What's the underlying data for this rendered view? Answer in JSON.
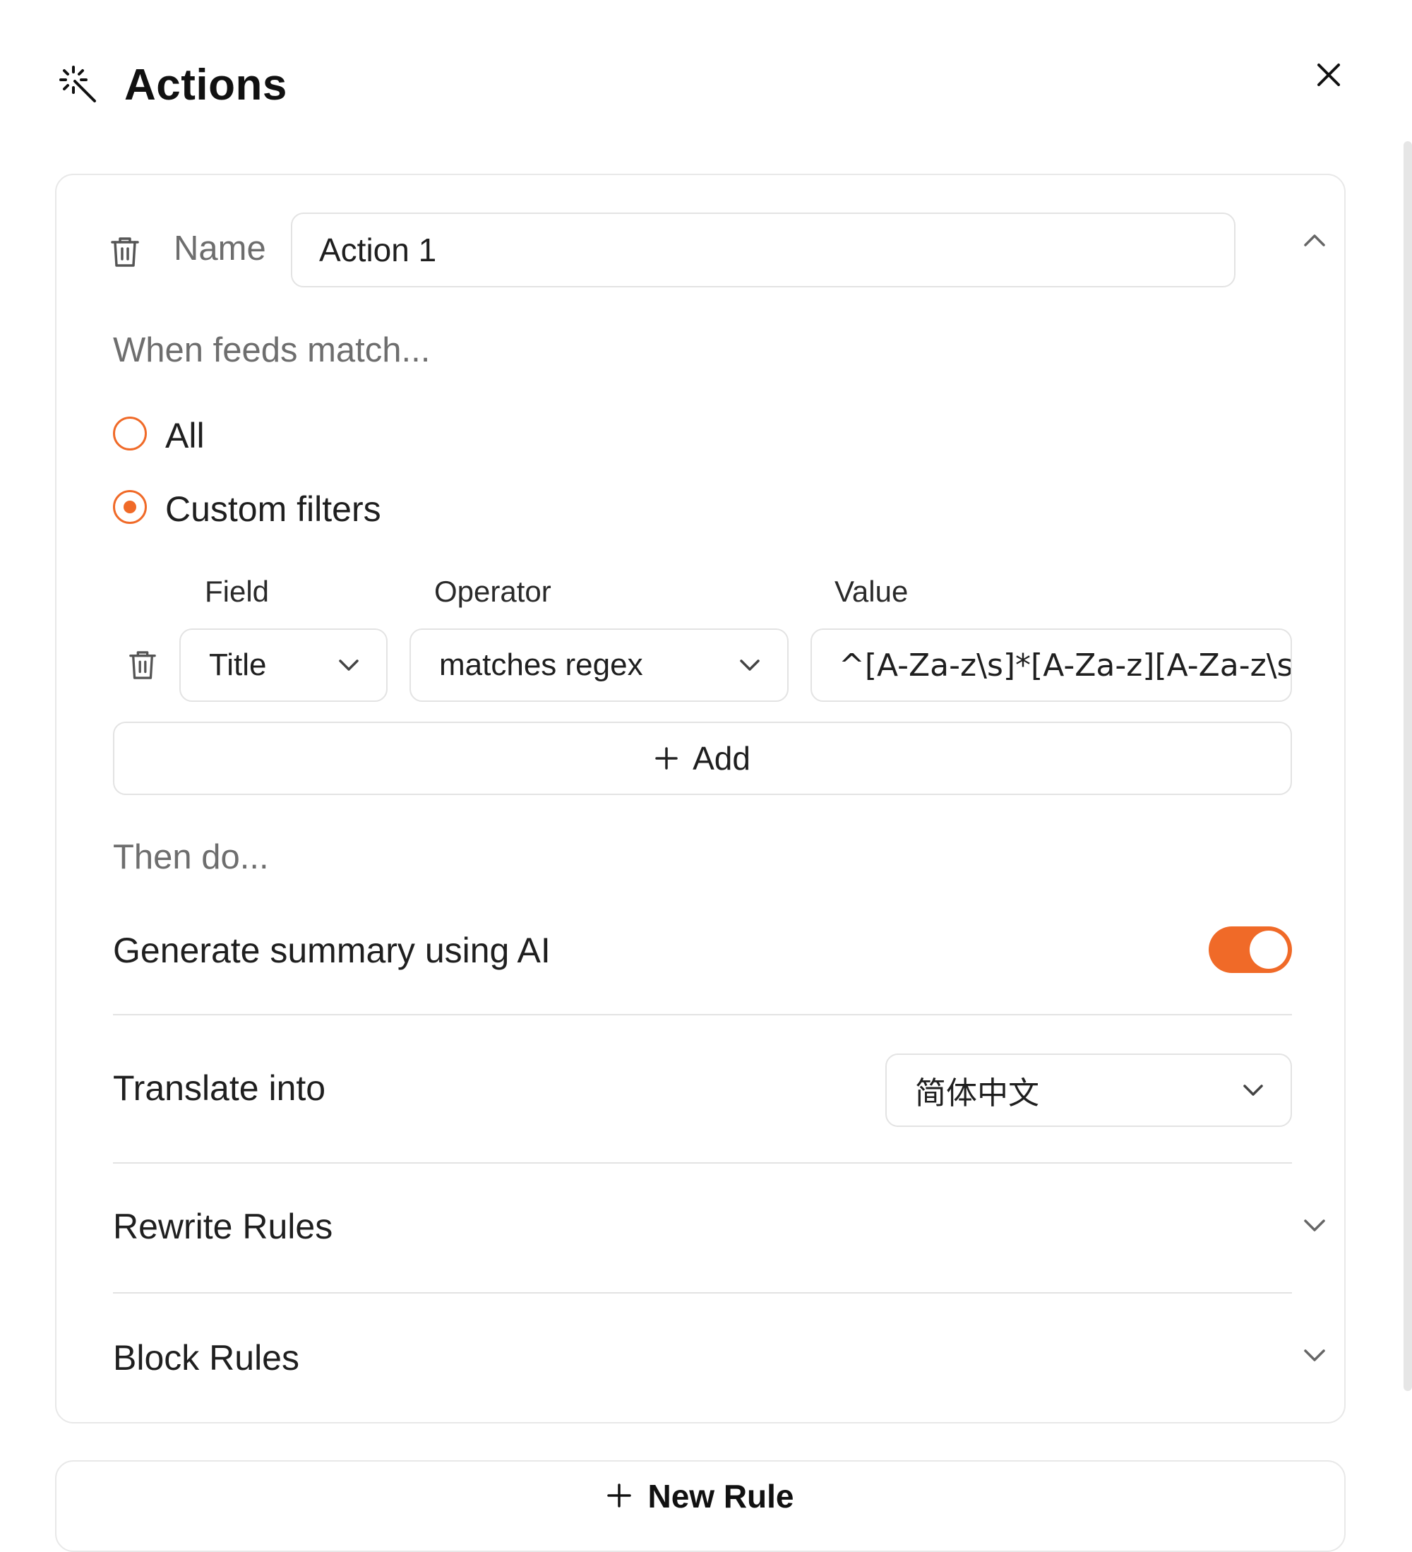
{
  "header": {
    "title": "Actions",
    "icon": "magic-wand-icon",
    "close_icon": "close-icon"
  },
  "action": {
    "name_label": "Name",
    "name_value": "Action 1",
    "when_title": "When feeds match...",
    "match_options": [
      {
        "label": "All",
        "selected": false
      },
      {
        "label": "Custom filters",
        "selected": true
      }
    ],
    "filter_columns": {
      "field": "Field",
      "operator": "Operator",
      "value": "Value"
    },
    "filter": {
      "field": "Title",
      "operator": "matches regex",
      "value": "^[A-Za-z\\s]*[A-Za-z][A-Za-z\\s]*$"
    },
    "add_label": "Add",
    "then_title": "Then do...",
    "summary_label": "Generate summary using AI",
    "summary_enabled": true,
    "translate_label": "Translate into",
    "translate_value": "简体中文",
    "rewrite_label": "Rewrite Rules",
    "block_label": "Block Rules"
  },
  "new_rule_label": "New Rule",
  "colors": {
    "accent": "#f06a28",
    "border": "#e3e3e3",
    "muted_text": "#6e6e6e"
  }
}
